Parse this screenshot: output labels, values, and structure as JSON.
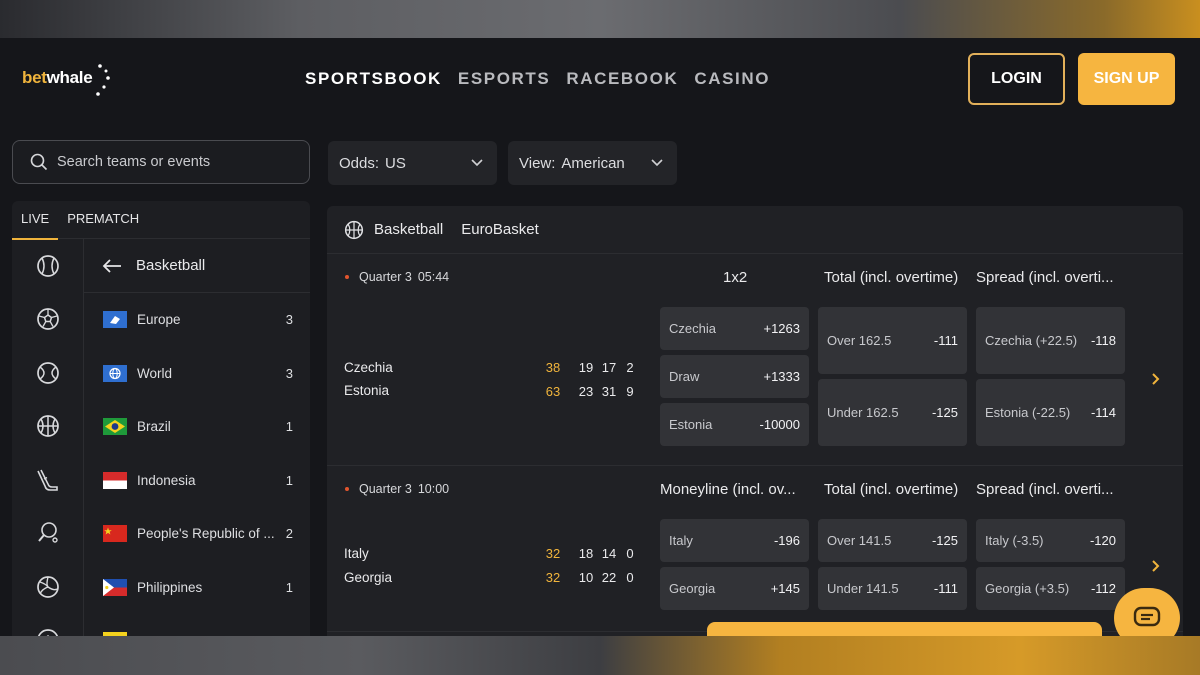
{
  "brand": {
    "logo_left": "bet",
    "logo_right": "whale",
    "accent": "#f6b540"
  },
  "nav": [
    {
      "label": "SPORTSBOOK",
      "active": true
    },
    {
      "label": "ESPORTS"
    },
    {
      "label": "RACEBOOK"
    },
    {
      "label": "CASINO"
    }
  ],
  "auth": {
    "login": "LOGIN",
    "signup": "SIGN UP"
  },
  "search": {
    "placeholder": "Search teams or events"
  },
  "odds_select": {
    "label": "Odds:",
    "value": "US"
  },
  "view_select": {
    "label": "View:",
    "value": "American"
  },
  "sidebar": {
    "tabs": [
      {
        "label": "LIVE",
        "active": true
      },
      {
        "label": "PREMATCH"
      }
    ],
    "sport_icons": [
      "baseball-icon",
      "soccer-icon",
      "tennis-icon",
      "basketball-icon",
      "ice-hockey-icon",
      "table-tennis-icon",
      "volleyball-icon",
      "handball-icon"
    ],
    "back_label": "Basketball",
    "categories": [
      {
        "name": "Europe",
        "count": "3",
        "flag": "europe-flag-icon"
      },
      {
        "name": "World",
        "count": "3",
        "flag": "world-flag-icon"
      },
      {
        "name": "Brazil",
        "count": "1",
        "flag": "brazil-flag-icon"
      },
      {
        "name": "Indonesia",
        "count": "1",
        "flag": "indonesia-flag-icon"
      },
      {
        "name": "People's Republic of ...",
        "count": "2",
        "flag": "china-flag-icon"
      },
      {
        "name": "Philippines",
        "count": "1",
        "flag": "philippines-flag-icon"
      }
    ]
  },
  "main": {
    "header": {
      "sport": "Basketball",
      "league": "EuroBasket"
    },
    "events": [
      {
        "status_period": "Quarter 3",
        "status_time": "05:44",
        "markets": [
          "1x2",
          "Total (incl. overtime)",
          "Spread (incl. overti..."
        ],
        "teams": [
          {
            "name": "Czechia",
            "total": "38",
            "q": [
              "19",
              "17",
              "2"
            ]
          },
          {
            "name": "Estonia",
            "total": "63",
            "q": [
              "23",
              "31",
              "9"
            ]
          }
        ],
        "col1": [
          {
            "label": "Czechia",
            "odds": "+1263"
          },
          {
            "label": "Draw",
            "odds": "+1333"
          },
          {
            "label": "Estonia",
            "odds": "-10000"
          }
        ],
        "col2": [
          {
            "label": "Over 162.5",
            "odds": "-111"
          },
          {
            "label": "Under 162.5",
            "odds": "-125"
          }
        ],
        "col3": [
          {
            "label": "Czechia (+22.5)",
            "odds": "-118"
          },
          {
            "label": "Estonia (-22.5)",
            "odds": "-114"
          }
        ]
      },
      {
        "status_period": "Quarter 3",
        "status_time": "10:00",
        "markets": [
          "Moneyline (incl. ov...",
          "Total (incl. overtime)",
          "Spread (incl. overti..."
        ],
        "teams": [
          {
            "name": "Italy",
            "total": "32",
            "q": [
              "18",
              "14",
              "0"
            ]
          },
          {
            "name": "Georgia",
            "total": "32",
            "q": [
              "10",
              "22",
              "0"
            ]
          }
        ],
        "col1": [
          {
            "label": "Italy",
            "odds": "-196"
          },
          {
            "label": "Georgia",
            "odds": "+145"
          }
        ],
        "col2": [
          {
            "label": "Over 141.5",
            "odds": "-125"
          },
          {
            "label": "Under 141.5",
            "odds": "-111"
          }
        ],
        "col3": [
          {
            "label": "Italy (-3.5)",
            "odds": "-120"
          },
          {
            "label": "Georgia (+3.5)",
            "odds": "-112"
          }
        ]
      }
    ]
  }
}
